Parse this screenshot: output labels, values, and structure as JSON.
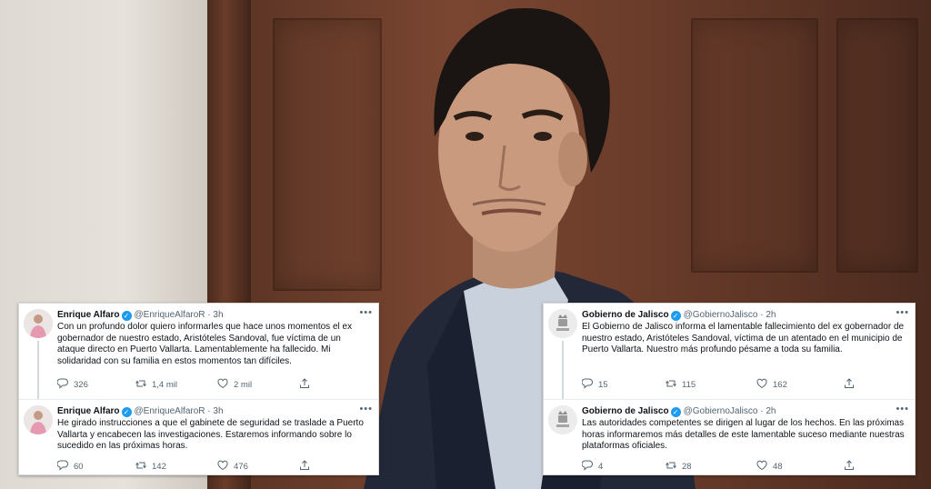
{
  "left_thread": {
    "tweets": [
      {
        "author": "Enrique Alfaro",
        "handle": "@EnriqueAlfaroR",
        "time": "· 3h",
        "text": "Con un profundo dolor quiero informarles que hace unos momentos el ex gobernador de nuestro estado, Aristóteles Sandoval, fue víctima de un ataque directo en Puerto Vallarta. Lamentablemente ha fallecido. Mi solidaridad con su familia en estos momentos tan difíciles.",
        "replies": "326",
        "retweets": "1,4 mil",
        "likes": "2 mil"
      },
      {
        "author": "Enrique Alfaro",
        "handle": "@EnriqueAlfaroR",
        "time": "· 3h",
        "text": "He girado instrucciones a que el gabinete de seguridad se traslade a Puerto Vallarta y encabecen las investigaciones. Estaremos informando sobre lo sucedido en las próximas horas.",
        "replies": "60",
        "retweets": "142",
        "likes": "476"
      }
    ]
  },
  "right_thread": {
    "tweets": [
      {
        "author": "Gobierno de Jalisco",
        "handle": "@GobiernoJalisco",
        "time": "· 2h",
        "text": "El Gobierno de Jalisco informa el lamentable fallecimiento del ex gobernador de nuestro estado, Aristóteles Sandoval, víctima de un atentado en el municipio de Puerto Vallarta. Nuestro más profundo pésame a toda su familia.",
        "replies": "15",
        "retweets": "115",
        "likes": "162"
      },
      {
        "author": "Gobierno de Jalisco",
        "handle": "@GobiernoJalisco",
        "time": "· 2h",
        "text": "Las autoridades competentes se dirigen al lugar de los hechos. En las próximas horas informaremos más detalles de este lamentable suceso mediante nuestras plataformas oficiales.",
        "replies": "4",
        "retweets": "28",
        "likes": "48"
      }
    ]
  },
  "icons": {
    "verified": "verified-badge-icon",
    "reply": "reply-icon",
    "retweet": "retweet-icon",
    "like": "heart-icon",
    "share": "share-icon",
    "more": "more-options-icon"
  },
  "colors": {
    "verified_blue": "#1d9bf0",
    "text_primary": "#0f1419",
    "text_secondary": "#536471"
  }
}
